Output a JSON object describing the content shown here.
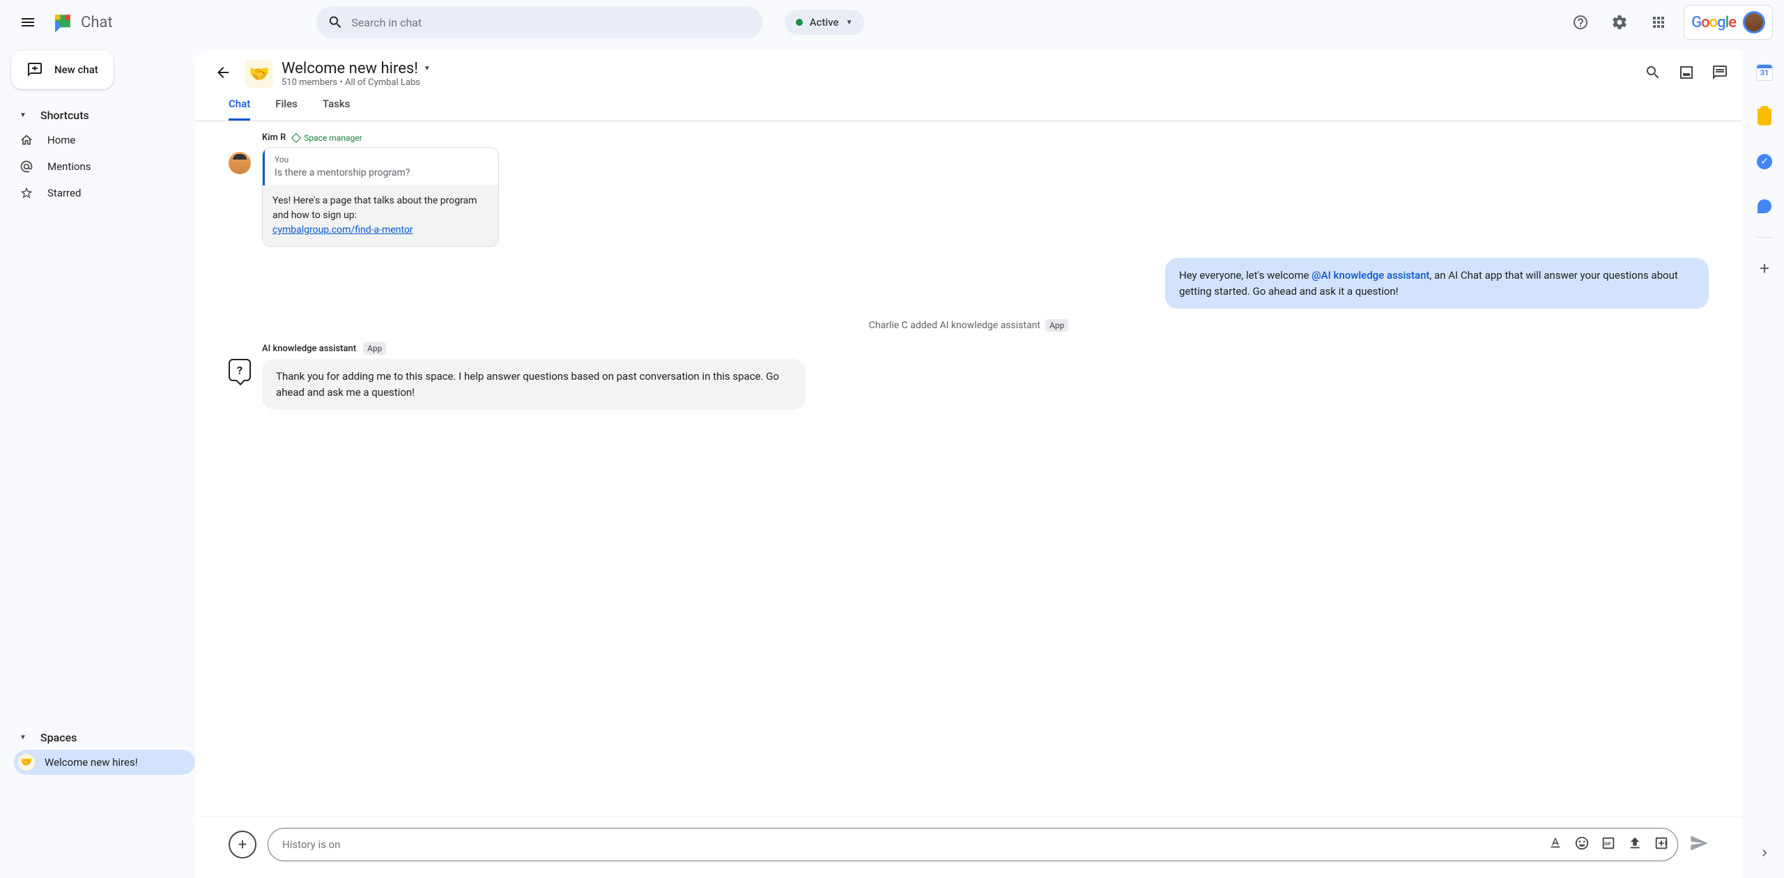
{
  "header": {
    "app_name": "Chat",
    "search_placeholder": "Search in chat",
    "status_label": "Active",
    "google_label": "Google"
  },
  "sidebar": {
    "new_chat_label": "New chat",
    "shortcuts_label": "Shortcuts",
    "home_label": "Home",
    "mentions_label": "Mentions",
    "starred_label": "Starred",
    "spaces_label": "Spaces",
    "space_name": "Welcome new hires!"
  },
  "space": {
    "title": "Welcome new hires!",
    "subtitle": "510 members  •  All of Cymbal Labs",
    "tabs": {
      "chat": "Chat",
      "files": "Files",
      "tasks": "Tasks"
    }
  },
  "messages": {
    "kim": {
      "author": "Kim R",
      "role": "Space manager",
      "quote_you": "You",
      "quote_text": "Is there a mentorship program?",
      "reply_text": "Yes! Here's a page that talks about the program and how to sign up:",
      "reply_link": "cymbalgroup.com/find-a-mentor"
    },
    "outgoing": {
      "pre": "Hey everyone, let's welcome ",
      "mention": "@AI knowledge assistant",
      "post": ", an AI Chat app that will answer your questions about getting started.  Go ahead and ask it a question!"
    },
    "system": {
      "text": "Charlie C added AI knowledge assistant",
      "badge": "App"
    },
    "ai": {
      "author": "AI knowledge assistant",
      "badge": "App",
      "text": "Thank you for adding me to this space. I help answer questions based on past conversation in this space. Go ahead and ask me a question!"
    }
  },
  "compose": {
    "placeholder": "History is on"
  },
  "side": {
    "calendar_day": "31"
  }
}
